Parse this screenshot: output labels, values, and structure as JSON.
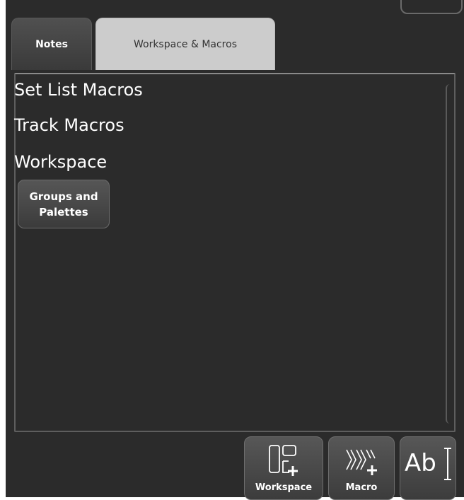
{
  "tabs": [
    {
      "label": "Notes",
      "selected": true
    },
    {
      "label": "Workspace & Macros",
      "selected": false
    }
  ],
  "list": {
    "items": [
      "Set List Macros",
      "Track Macros",
      "Workspace"
    ]
  },
  "workspace_buttons": [
    {
      "label_line1": "Groups and",
      "label_line2": "Palettes"
    }
  ],
  "toolbar": {
    "workspace_label": "Workspace",
    "workspace_icon": "workspace-add-icon",
    "macro_label": "Macro",
    "macro_icon": "macro-add-icon",
    "text_glyph": "Ab",
    "text_icon": "text-cursor-icon"
  },
  "colors": {
    "background": "#2b2b2b",
    "selected_tab": "#cccccc",
    "button": "#4a4a4a",
    "text": "#ffffff"
  }
}
